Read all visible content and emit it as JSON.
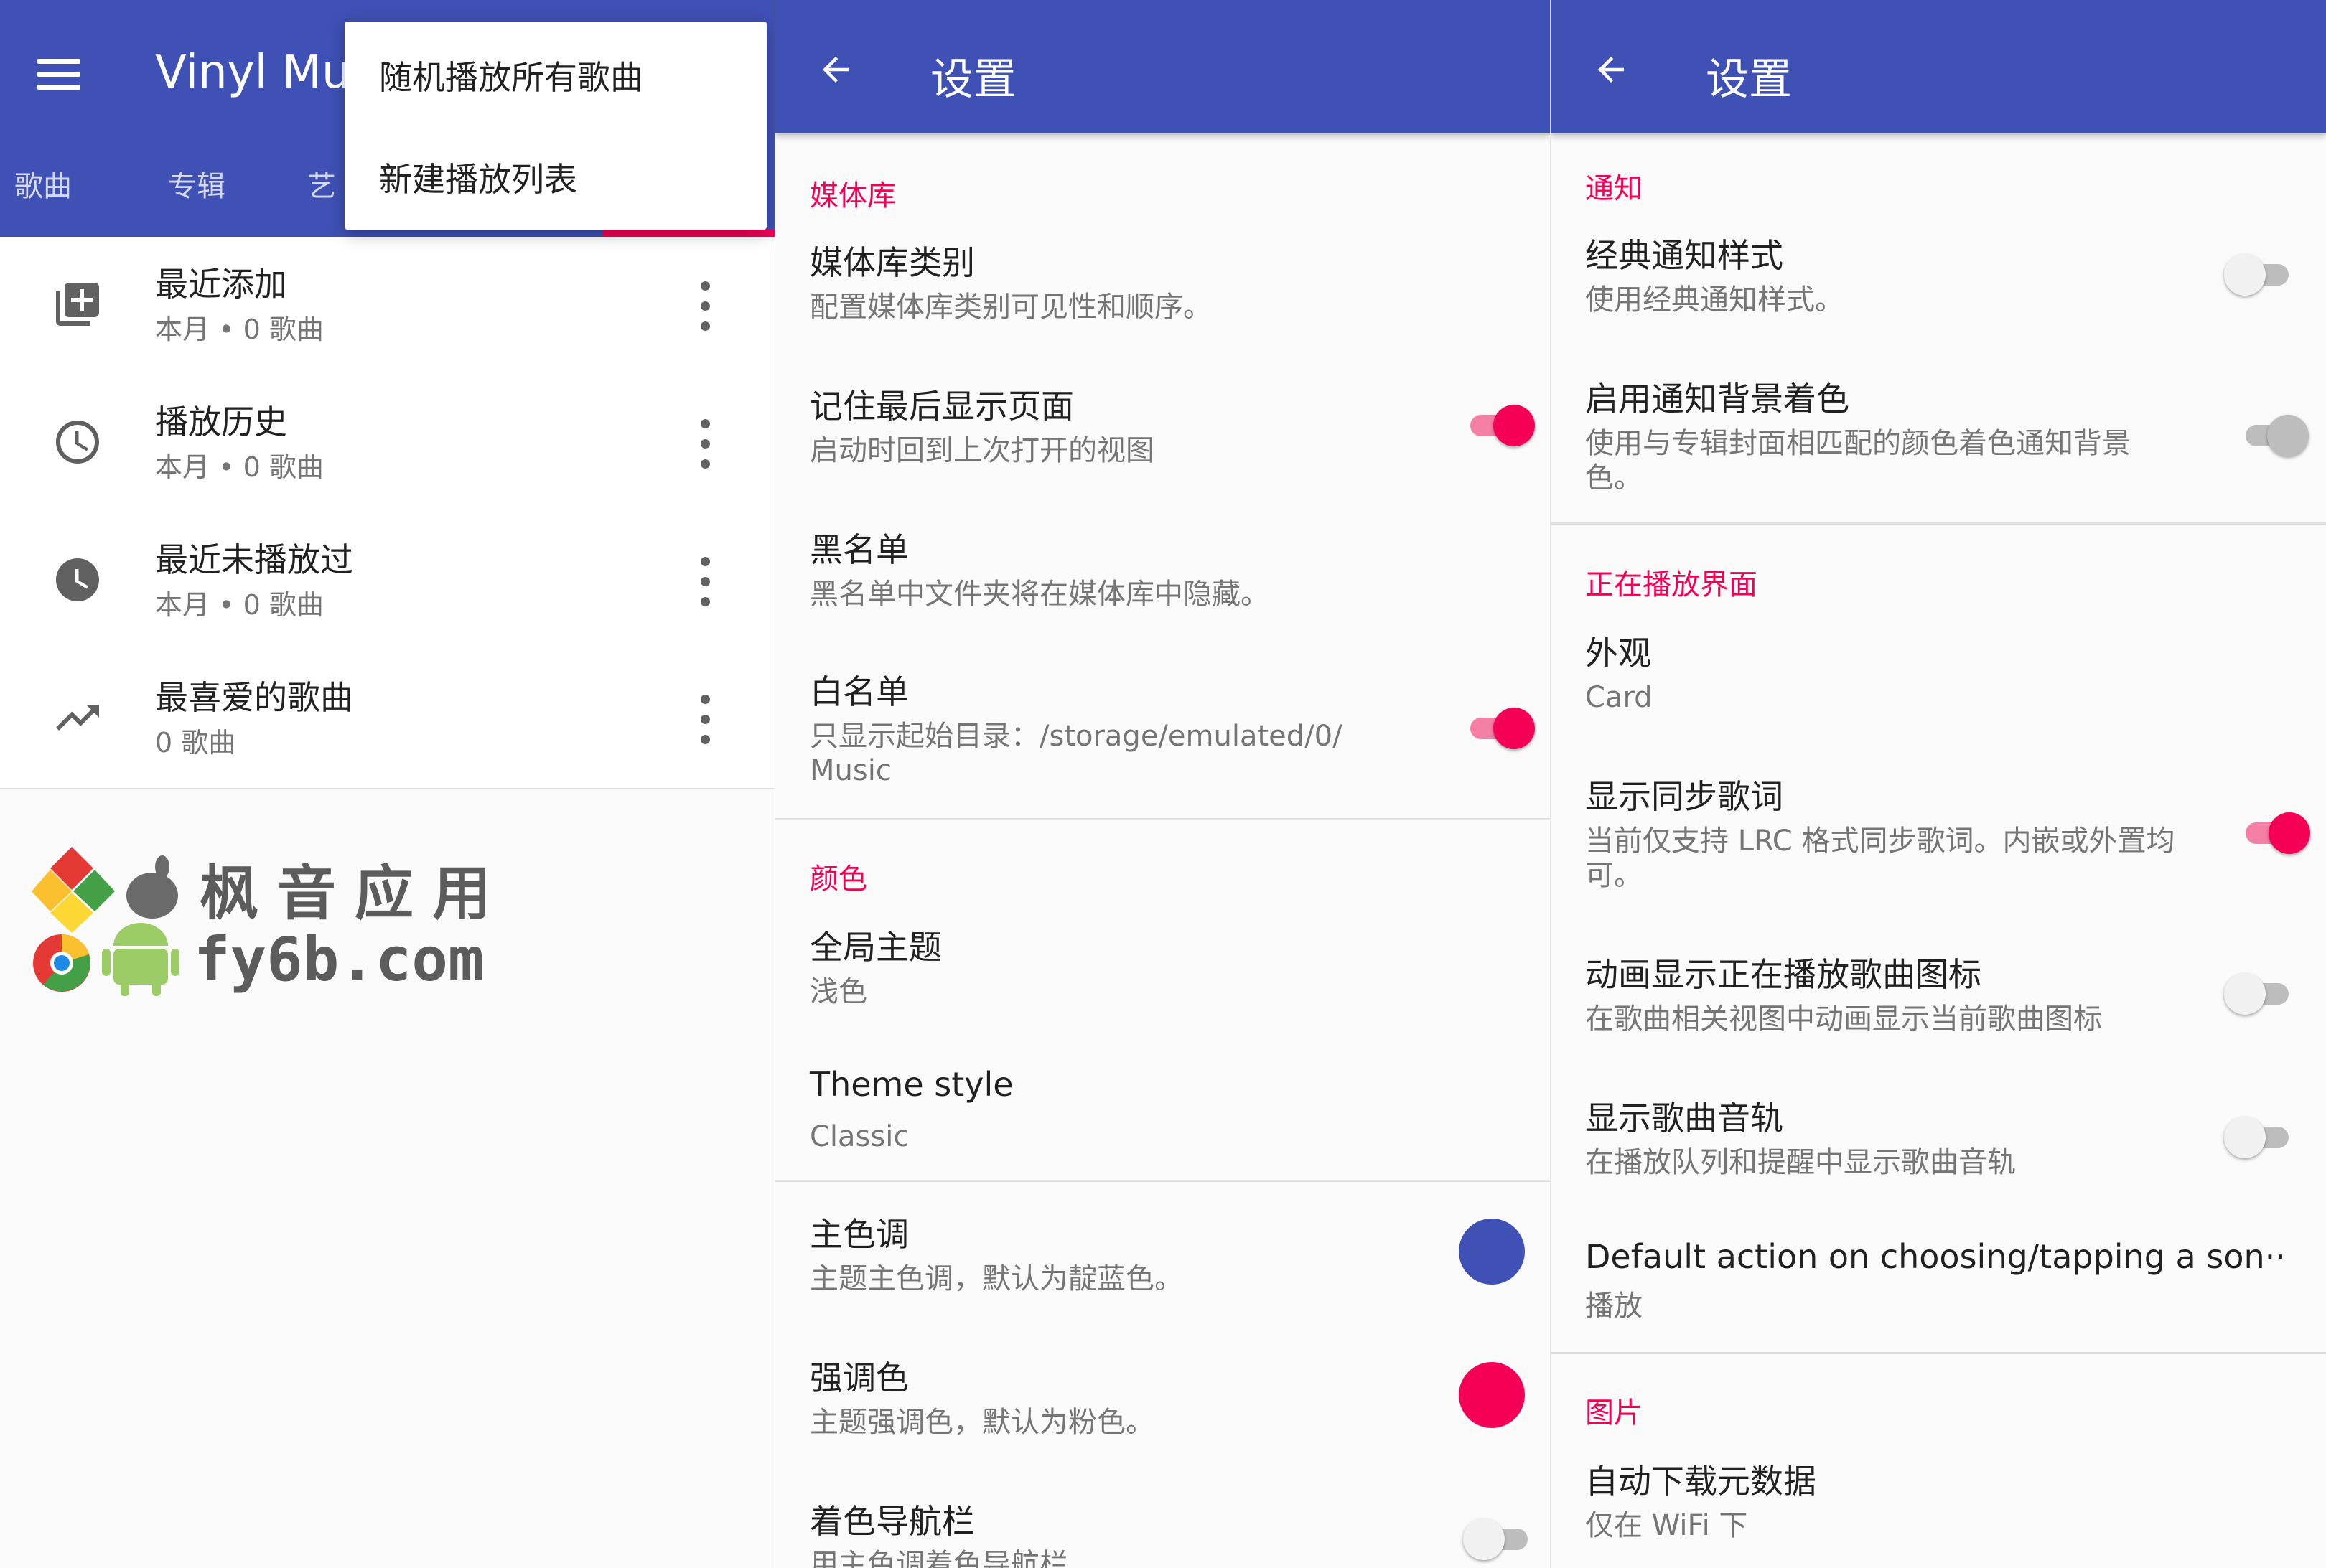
{
  "colors": {
    "primary": "#3F51B5",
    "accent": "#F50057",
    "background": "#FAFAFA",
    "primary_swatch": "#3F51B5",
    "accent_swatch": "#F50057"
  },
  "library": {
    "app_title": "Vinyl Mus",
    "menu_icon": "hamburger-menu-icon",
    "tabs": [
      {
        "label": "歌曲"
      },
      {
        "label": "专辑"
      },
      {
        "label": "艺"
      }
    ],
    "overflow_menu": [
      {
        "label": "随机播放所有歌曲"
      },
      {
        "label": "新建播放列表"
      }
    ],
    "playlists": [
      {
        "icon": "playlist-add-icon",
        "title": "最近添加",
        "subtitle": "本月 • 0 歌曲"
      },
      {
        "icon": "history-icon",
        "title": "播放历史",
        "subtitle": "本月 • 0 歌曲"
      },
      {
        "icon": "clock-filled-icon",
        "title": "最近未播放过",
        "subtitle": "本月 • 0 歌曲"
      },
      {
        "icon": "trending-up-icon",
        "title": "最喜爱的歌曲",
        "subtitle": "0 歌曲"
      }
    ],
    "watermark": {
      "line1": "枫音应用",
      "line2": "fy6b.com"
    }
  },
  "settings_left": {
    "title": "设置",
    "categories": {
      "media": "媒体库",
      "colors": "颜色"
    },
    "items": [
      {
        "title": "媒体库类别",
        "summary": "配置媒体库类别可见性和顺序。"
      },
      {
        "title": "记住最后显示页面",
        "summary": "启动时回到上次打开的视图",
        "switch": true
      },
      {
        "title": "黑名单",
        "summary": "黑名单中文件夹将在媒体库中隐藏。"
      },
      {
        "title": "白名单",
        "summary": "只显示起始目录：/storage/emulated/0/ Music",
        "switch": true
      },
      {
        "title": "全局主题",
        "summary": "浅色"
      },
      {
        "title": "Theme style",
        "summary": "Classic"
      },
      {
        "title": "主色调",
        "summary": "主题主色调，默认为靛蓝色。"
      },
      {
        "title": "强调色",
        "summary": "主题强调色，默认为粉色。"
      },
      {
        "title": "着色导航栏",
        "summary": "用主色调着色导航栏",
        "switch": false
      }
    ]
  },
  "settings_right": {
    "title": "设置",
    "categories": {
      "notification": "通知",
      "now_playing": "正在播放界面",
      "images": "图片"
    },
    "items": [
      {
        "title": "经典通知样式",
        "summary": "使用经典通知样式。",
        "switch": false
      },
      {
        "title": "启用通知背景着色",
        "summary": "使用与专辑封面相匹配的颜色着色通知背景色。",
        "switch": false
      },
      {
        "title": "外观",
        "summary": "Card"
      },
      {
        "title": "显示同步歌词",
        "summary": "当前仅支持 LRC 格式同步歌词。内嵌或外置均可。",
        "switch": true
      },
      {
        "title": "动画显示正在播放歌曲图标",
        "summary": "在歌曲相关视图中动画显示当前歌曲图标",
        "switch": false
      },
      {
        "title": "显示歌曲音轨",
        "summary": "在播放队列和提醒中显示歌曲音轨",
        "switch": false
      },
      {
        "title": "Default action on choosing/tapping a son··",
        "summary": "播放"
      },
      {
        "title": "自动下载元数据",
        "summary": "仅在 WiFi 下"
      }
    ]
  }
}
